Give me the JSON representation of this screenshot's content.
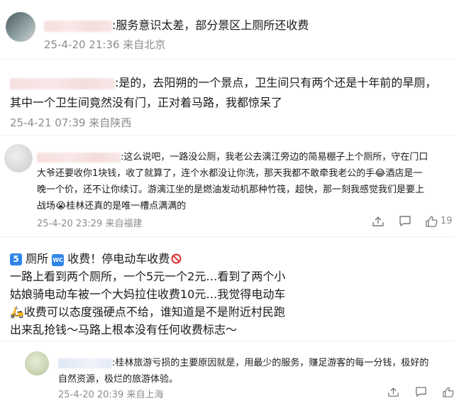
{
  "comments": [
    {
      "text": ":服务意识太差，部分景区上厕所还收费",
      "meta": "25-4-20 21:36 来自北京"
    },
    {
      "line1": ":是的，去阳朔的一个景点，卫生间只有两个还是十年前的旱厕，",
      "line2": "其中一个卫生间竟然没有门，正对着马路，我都惊呆了",
      "meta": "25-4-21 07:39 来自陕西"
    },
    {
      "line1": ":这么说吧，一路没公厕，我老公去漓江旁边的简易棚子上个厕所，守在门口",
      "line2": "大爷还要收你1块钱，收了就算了，连个水都没让你洗，那天我都不敢牵我老公的手",
      "line2b": "酒店是一",
      "line3": "晚一个价，还不让你续订。游漓江坐的是燃油发动机那种竹筏，超快，那一刻我感觉我们是要上",
      "line4": "战场",
      "line4b": "桂林还真的是唯一槽点满满的",
      "meta": "25-4-20 23:29 来自福建",
      "like_count": "19"
    }
  ],
  "post": {
    "badge_text": "5",
    "wc_badge": "WC",
    "line1_a": "厕所",
    "line1_b": "收费！停电动车收费",
    "line2": "一路上看到两个厕所，一个5元一个2元…看到了两个小",
    "line3": "姑娘骑电动车被一个大妈拉住收费10元…我觉得电动车",
    "line4": "收费可以态度强硬点不给，谁知道是不是附近村民跑",
    "line5": "出来乱抢钱～马路上根本没有任何收费标志～"
  },
  "reply": {
    "line1": ":桂林旅游亏损的主要原因就是，用最少的服务，赚足游客的每一分钱，极好的",
    "line2": "自然资源，极烂的旅游体验。",
    "meta": "25-4-20 20:39 来自上海"
  },
  "icons": [
    "share-icon",
    "comment-icon",
    "like-icon",
    "laugh-cry-emoji",
    "crying-emoji",
    "scooter-emoji",
    "prohibited-icon"
  ]
}
